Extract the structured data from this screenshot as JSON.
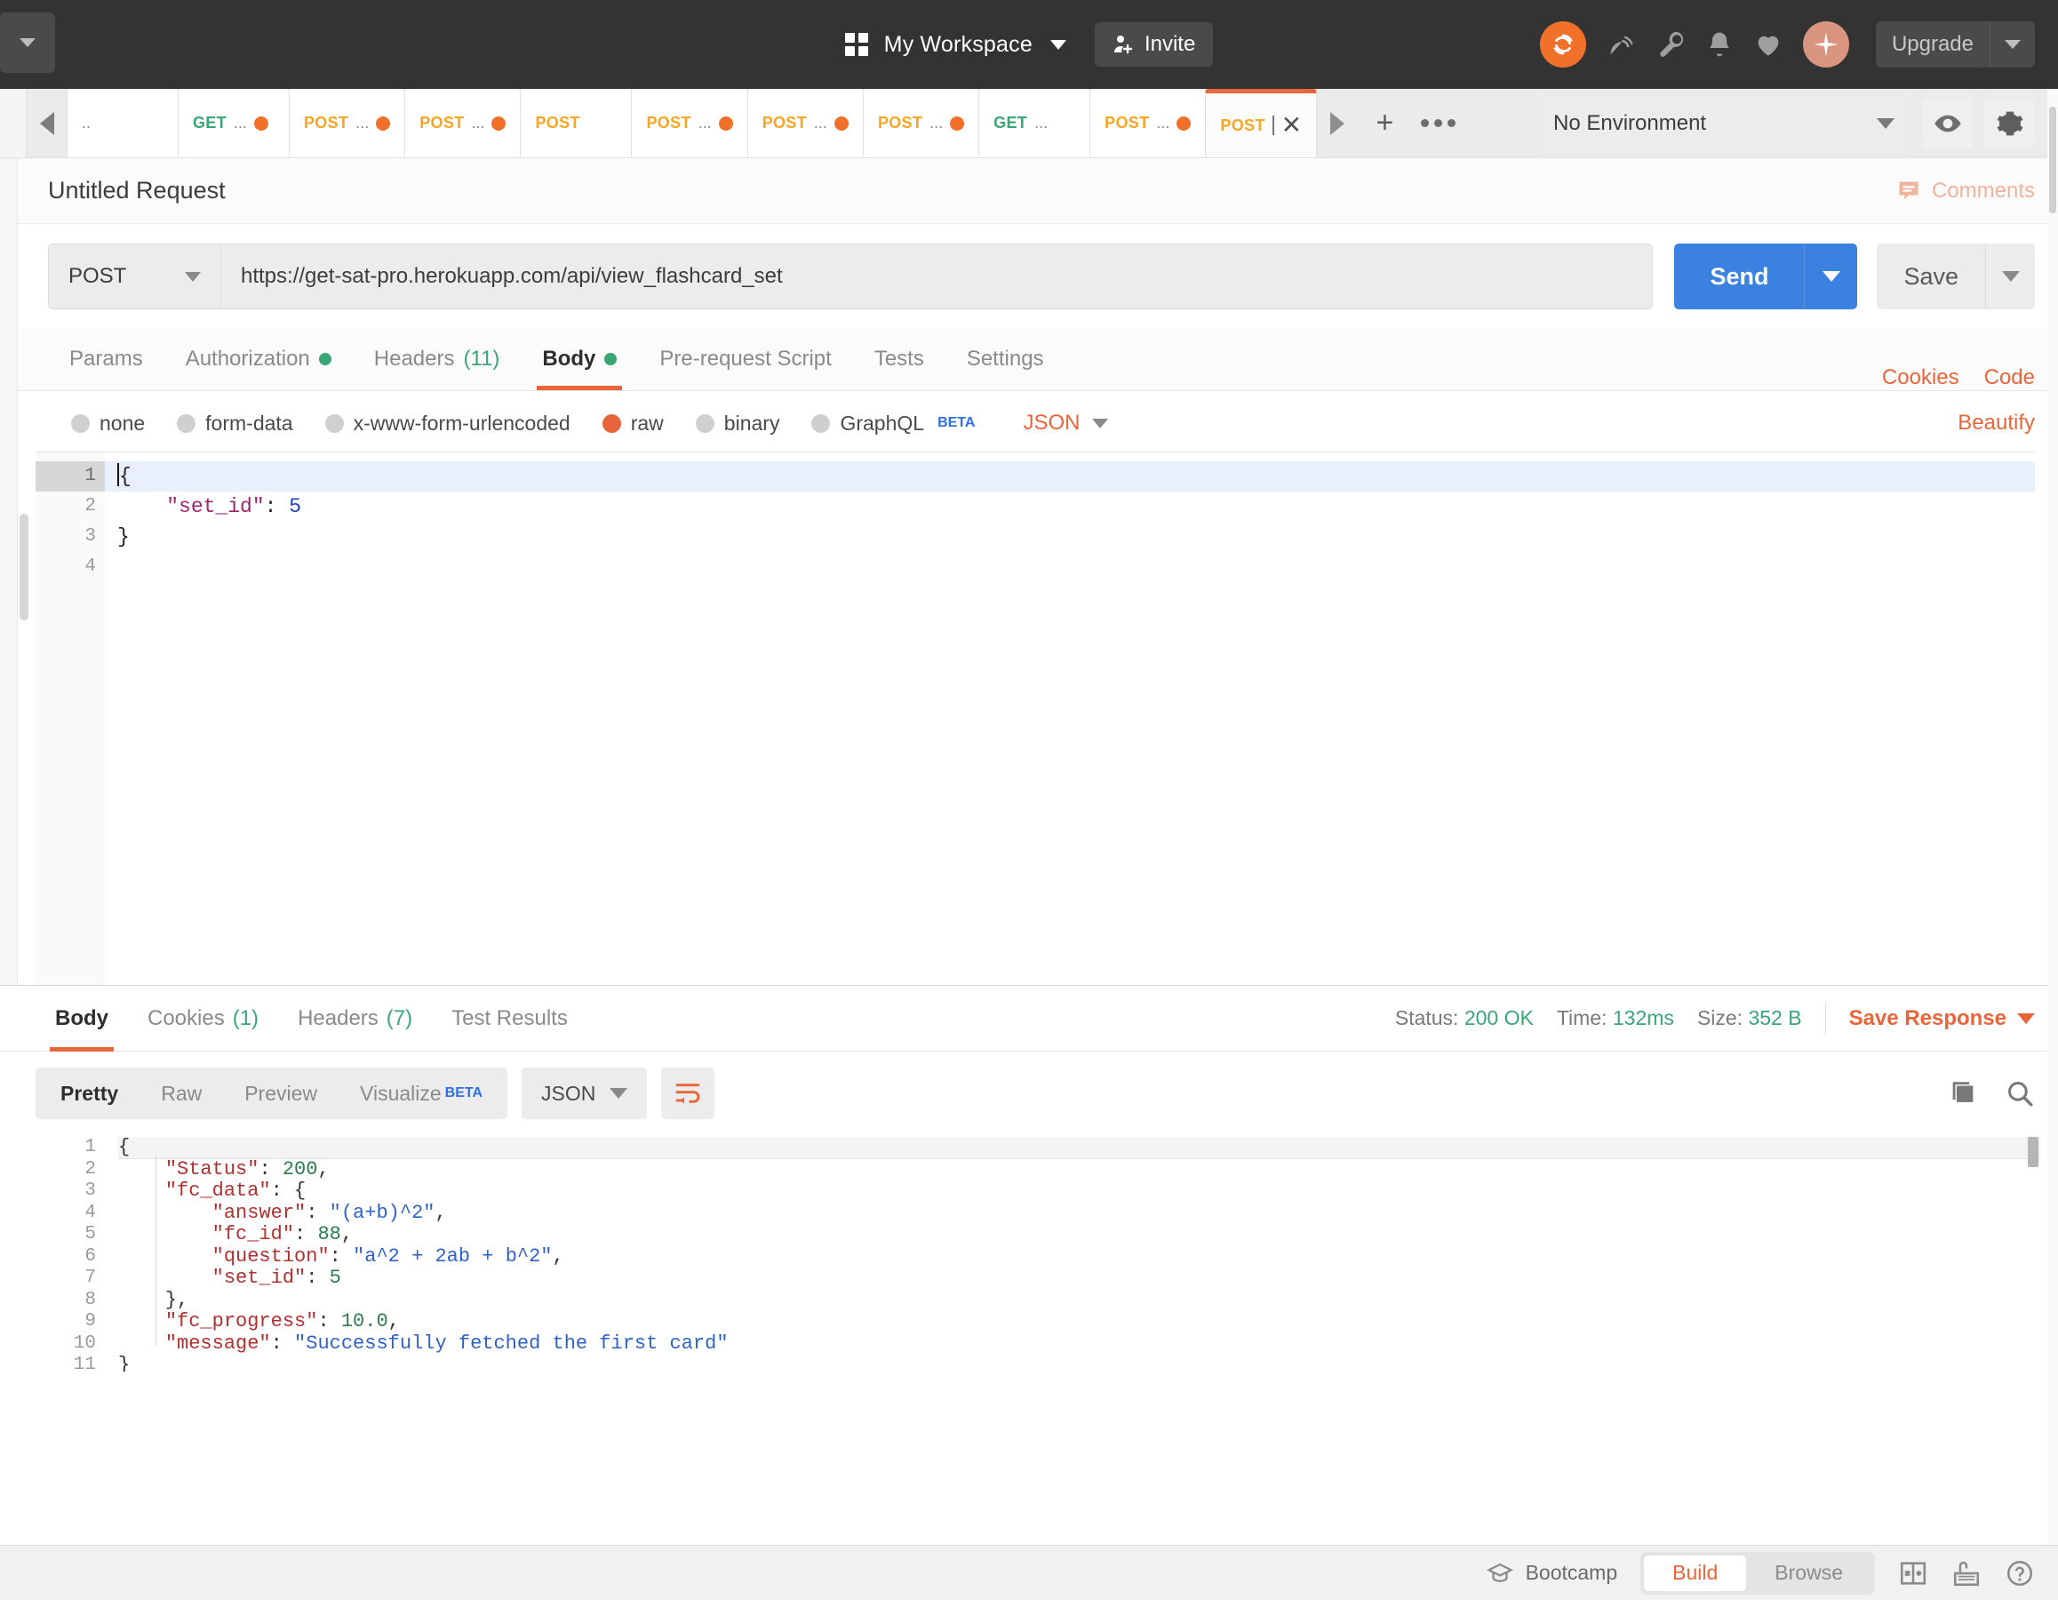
{
  "header": {
    "workspace_name": "My Workspace",
    "invite_label": "Invite",
    "upgrade_label": "Upgrade",
    "icons": [
      "sync-icon",
      "satellite-icon",
      "wrench-icon",
      "bell-icon",
      "heart-icon",
      "sparkle-icon"
    ],
    "accent": "#f1712b"
  },
  "tabstrip": {
    "tabs": [
      {
        "method": "",
        "label": "..",
        "unsaved": false,
        "active": false
      },
      {
        "method": "GET",
        "label": "...",
        "unsaved": true,
        "active": false
      },
      {
        "method": "POST",
        "label": "...",
        "unsaved": true,
        "active": false
      },
      {
        "method": "POST",
        "label": "...",
        "unsaved": true,
        "active": false
      },
      {
        "method": "POST",
        "label": "",
        "unsaved": false,
        "active": false
      },
      {
        "method": "POST",
        "label": "...",
        "unsaved": true,
        "active": false
      },
      {
        "method": "POST",
        "label": "...",
        "unsaved": true,
        "active": false
      },
      {
        "method": "POST",
        "label": "...",
        "unsaved": true,
        "active": false
      },
      {
        "method": "GET",
        "label": "...",
        "unsaved": false,
        "active": false
      },
      {
        "method": "POST",
        "label": "...",
        "unsaved": true,
        "active": false
      },
      {
        "method": "POST",
        "label": "",
        "unsaved": false,
        "active": true
      }
    ],
    "new_tab_label": "+",
    "environment": {
      "selected": "No Environment"
    }
  },
  "request": {
    "title": "Untitled Request",
    "comments_label": "Comments",
    "method": "POST",
    "url": "https://get-sat-pro.herokuapp.com/api/view_flashcard_set",
    "send_label": "Send",
    "save_label": "Save",
    "tabs": [
      {
        "label": "Params",
        "badge": "",
        "dot": false,
        "active": false
      },
      {
        "label": "Authorization",
        "badge": "",
        "dot": true,
        "active": false
      },
      {
        "label": "Headers",
        "badge": "(11)",
        "dot": false,
        "active": false
      },
      {
        "label": "Body",
        "badge": "",
        "dot": true,
        "active": true
      },
      {
        "label": "Pre-request Script",
        "badge": "",
        "dot": false,
        "active": false
      },
      {
        "label": "Tests",
        "badge": "",
        "dot": false,
        "active": false
      },
      {
        "label": "Settings",
        "badge": "",
        "dot": false,
        "active": false
      }
    ],
    "right_links": [
      "Cookies",
      "Code"
    ],
    "body_types": [
      {
        "label": "none",
        "selected": false
      },
      {
        "label": "form-data",
        "selected": false
      },
      {
        "label": "x-www-form-urlencoded",
        "selected": false
      },
      {
        "label": "raw",
        "selected": true
      },
      {
        "label": "binary",
        "selected": false
      },
      {
        "label": "GraphQL",
        "selected": false,
        "beta": "BETA"
      }
    ],
    "format": "JSON",
    "beautify_label": "Beautify",
    "editor": {
      "line_numbers": [
        "1",
        "2",
        "3",
        "4"
      ],
      "lines": [
        {
          "segments": [
            {
              "t": "{",
              "c": "tok-punc"
            }
          ]
        },
        {
          "segments": [
            {
              "t": "    ",
              "c": "tok-punc"
            },
            {
              "t": "\"set_id\"",
              "c": "tok-key"
            },
            {
              "t": ": ",
              "c": "tok-punc"
            },
            {
              "t": "5",
              "c": "tok-num"
            }
          ]
        },
        {
          "segments": [
            {
              "t": "}",
              "c": "tok-punc"
            }
          ]
        },
        {
          "segments": []
        }
      ]
    }
  },
  "response": {
    "tabs": [
      {
        "label": "Body",
        "badge": "",
        "active": true
      },
      {
        "label": "Cookies",
        "badge": "(1)",
        "active": false
      },
      {
        "label": "Headers",
        "badge": "(7)",
        "active": false
      },
      {
        "label": "Test Results",
        "badge": "",
        "active": false
      }
    ],
    "status_label": "Status:",
    "status_value": "200 OK",
    "time_label": "Time:",
    "time_value": "132ms",
    "size_label": "Size:",
    "size_value": "352 B",
    "save_response_label": "Save Response",
    "view_modes": [
      {
        "label": "Pretty",
        "active": true
      },
      {
        "label": "Raw",
        "active": false
      },
      {
        "label": "Preview",
        "active": false
      },
      {
        "label": "Visualize",
        "active": false,
        "beta": "BETA"
      }
    ],
    "format": "JSON",
    "body": {
      "line_numbers": [
        "1",
        "2",
        "3",
        "4",
        "5",
        "6",
        "7",
        "8",
        "9",
        "10",
        "11"
      ],
      "lines": [
        {
          "segments": [
            {
              "t": "{",
              "c": "rp"
            }
          ]
        },
        {
          "segments": [
            {
              "t": "    ",
              "c": "rp"
            },
            {
              "t": "\"Status\"",
              "c": "rk"
            },
            {
              "t": ": ",
              "c": "rp"
            },
            {
              "t": "200",
              "c": "rn"
            },
            {
              "t": ",",
              "c": "rp"
            }
          ]
        },
        {
          "segments": [
            {
              "t": "    ",
              "c": "rp"
            },
            {
              "t": "\"fc_data\"",
              "c": "rk"
            },
            {
              "t": ": {",
              "c": "rp"
            }
          ]
        },
        {
          "segments": [
            {
              "t": "        ",
              "c": "rp"
            },
            {
              "t": "\"answer\"",
              "c": "rk"
            },
            {
              "t": ": ",
              "c": "rp"
            },
            {
              "t": "\"(a+b)^2\"",
              "c": "rs"
            },
            {
              "t": ",",
              "c": "rp"
            }
          ]
        },
        {
          "segments": [
            {
              "t": "        ",
              "c": "rp"
            },
            {
              "t": "\"fc_id\"",
              "c": "rk"
            },
            {
              "t": ": ",
              "c": "rp"
            },
            {
              "t": "88",
              "c": "rn"
            },
            {
              "t": ",",
              "c": "rp"
            }
          ]
        },
        {
          "segments": [
            {
              "t": "        ",
              "c": "rp"
            },
            {
              "t": "\"question\"",
              "c": "rk"
            },
            {
              "t": ": ",
              "c": "rp"
            },
            {
              "t": "\"a^2 + 2ab + b^2\"",
              "c": "rs"
            },
            {
              "t": ",",
              "c": "rp"
            }
          ]
        },
        {
          "segments": [
            {
              "t": "        ",
              "c": "rp"
            },
            {
              "t": "\"set_id\"",
              "c": "rk"
            },
            {
              "t": ": ",
              "c": "rp"
            },
            {
              "t": "5",
              "c": "rn"
            }
          ]
        },
        {
          "segments": [
            {
              "t": "    },",
              "c": "rp"
            }
          ]
        },
        {
          "segments": [
            {
              "t": "    ",
              "c": "rp"
            },
            {
              "t": "\"fc_progress\"",
              "c": "rk"
            },
            {
              "t": ": ",
              "c": "rp"
            },
            {
              "t": "10.0",
              "c": "rn"
            },
            {
              "t": ",",
              "c": "rp"
            }
          ]
        },
        {
          "segments": [
            {
              "t": "    ",
              "c": "rp"
            },
            {
              "t": "\"message\"",
              "c": "rk"
            },
            {
              "t": ": ",
              "c": "rp"
            },
            {
              "t": "\"Successfully fetched the first card\"",
              "c": "rs"
            }
          ]
        },
        {
          "segments": [
            {
              "t": "}",
              "c": "rp"
            }
          ]
        }
      ]
    }
  },
  "statusbar": {
    "bootcamp_label": "Bootcamp",
    "modes": [
      {
        "label": "Build",
        "active": true
      },
      {
        "label": "Browse",
        "active": false
      }
    ]
  }
}
